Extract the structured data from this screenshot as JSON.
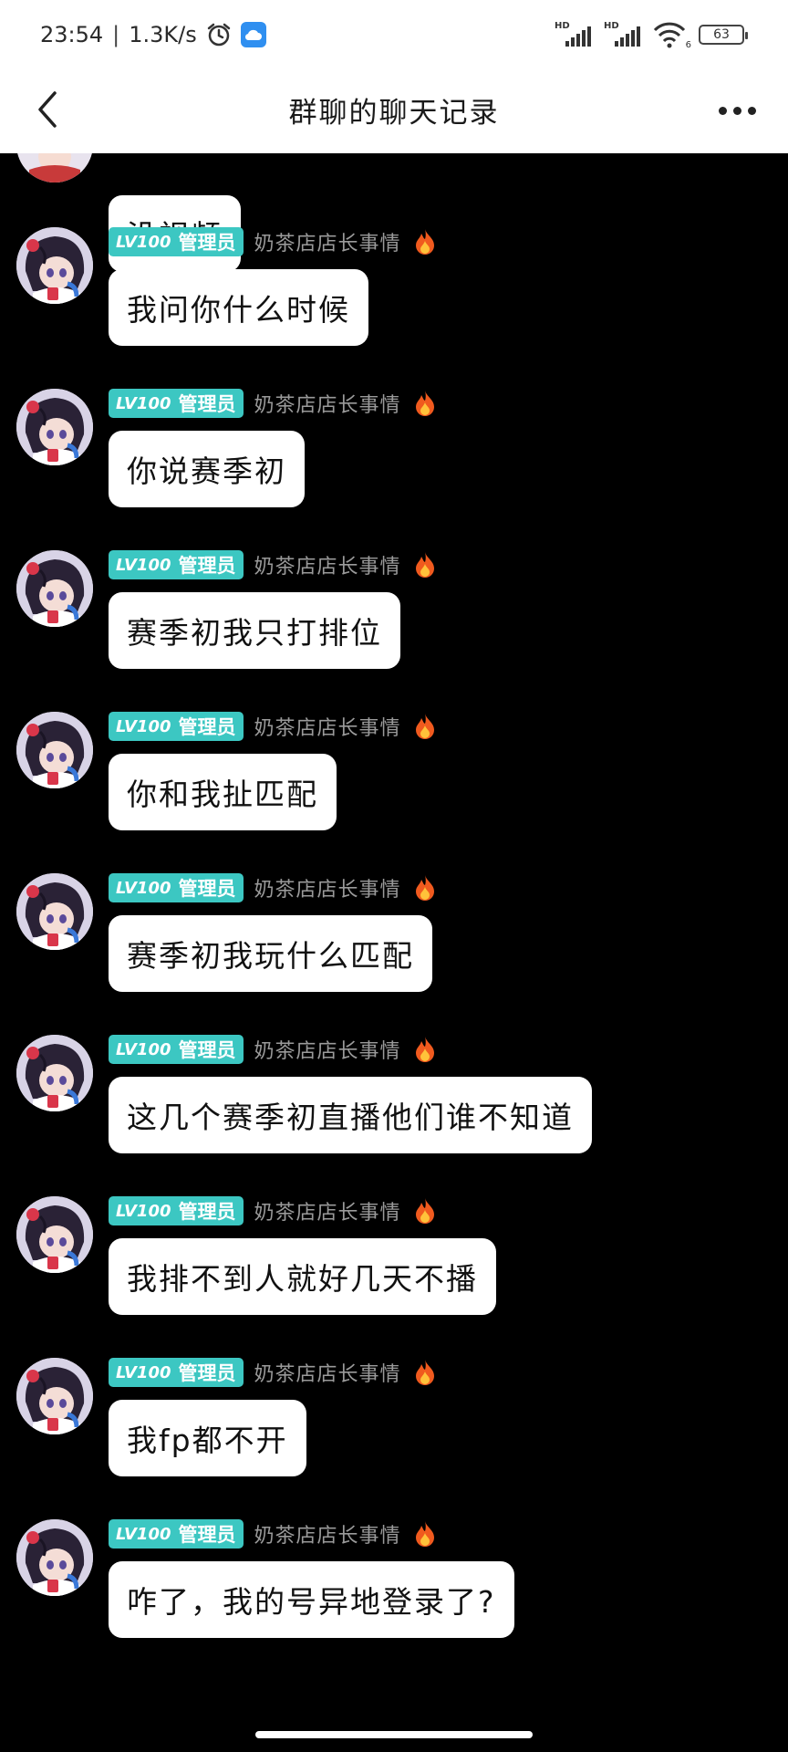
{
  "status_bar": {
    "time": "23:54",
    "separator": "|",
    "net_speed": "1.3K/s",
    "signal_label_1": "HD",
    "signal_label_2": "HD",
    "wifi_sub": "6",
    "battery": "63"
  },
  "header": {
    "title": "群聊的聊天记录"
  },
  "first_message": {
    "text": "没视频"
  },
  "messages": [
    {
      "level": "LV100",
      "role": "管理员",
      "sender": "奶茶店店长事情",
      "text": "我问你什么时候"
    },
    {
      "level": "LV100",
      "role": "管理员",
      "sender": "奶茶店店长事情",
      "text": "你说赛季初"
    },
    {
      "level": "LV100",
      "role": "管理员",
      "sender": "奶茶店店长事情",
      "text": "赛季初我只打排位"
    },
    {
      "level": "LV100",
      "role": "管理员",
      "sender": "奶茶店店长事情",
      "text": "你和我扯匹配"
    },
    {
      "level": "LV100",
      "role": "管理员",
      "sender": "奶茶店店长事情",
      "text": "赛季初我玩什么匹配"
    },
    {
      "level": "LV100",
      "role": "管理员",
      "sender": "奶茶店店长事情",
      "text": "这几个赛季初直播他们谁不知道"
    },
    {
      "level": "LV100",
      "role": "管理员",
      "sender": "奶茶店店长事情",
      "text": "我排不到人就好几天不播"
    },
    {
      "level": "LV100",
      "role": "管理员",
      "sender": "奶茶店店长事情",
      "text": "我fp都不开"
    },
    {
      "level": "LV100",
      "role": "管理员",
      "sender": "奶茶店店长事情",
      "text": "咋了，我的号异地登录了?"
    }
  ],
  "colors": {
    "background": "#000000",
    "bubble": "#ffffff",
    "badge": "#3cc7c2",
    "sender_text": "#9a9a9a"
  },
  "icons": [
    "back-arrow-icon",
    "more-dots-icon",
    "alarm-clock-icon",
    "cloud-icon",
    "wifi-icon",
    "fire-icon",
    "avatar"
  ]
}
